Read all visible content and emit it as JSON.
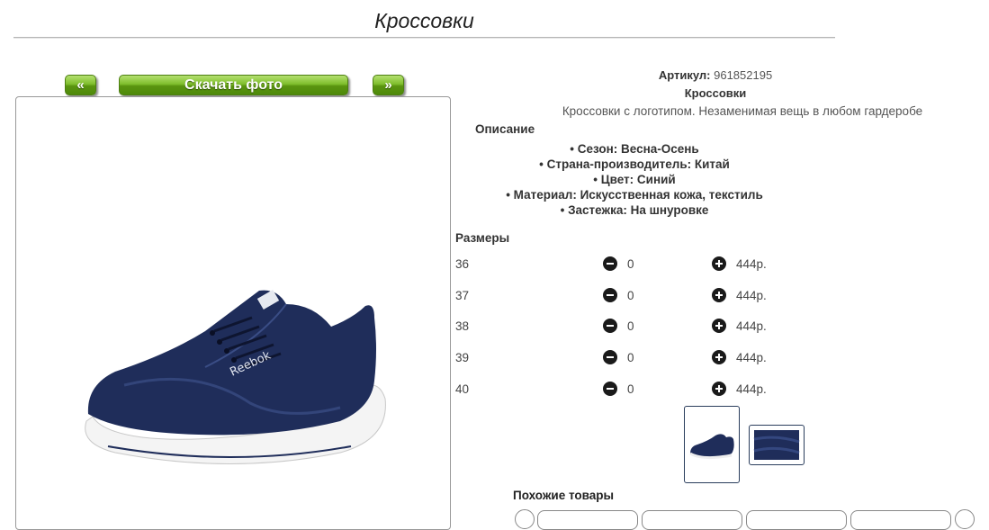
{
  "page_title": "Кроссовки",
  "nav": {
    "prev_label": "«",
    "download_label": "Скачать фото",
    "next_label": "»"
  },
  "product": {
    "sku_label": "Артикул:",
    "sku_value": "961852195",
    "name": "Кроссовки",
    "short_description": "Кроссовки с логотипом. Незаменимая вещь в любом гардеробе",
    "description_heading": "Описание",
    "features": [
      "• Сезон: Весна-Осень",
      "• Страна-производитель: Китай",
      "• Цвет: Синий",
      "• Материал: Искусственная кожа, текстиль",
      "• Застежка: На шнуровке"
    ],
    "shoe_logo_text": "Reebok"
  },
  "sizes": {
    "heading": "Размеры",
    "rows": [
      {
        "size": "36",
        "qty": "0",
        "price": "444р."
      },
      {
        "size": "37",
        "qty": "0",
        "price": "444р."
      },
      {
        "size": "38",
        "qty": "0",
        "price": "444р."
      },
      {
        "size": "39",
        "qty": "0",
        "price": "444р."
      },
      {
        "size": "40",
        "qty": "0",
        "price": "444р."
      }
    ]
  },
  "similar": {
    "heading": "Похожие товары"
  },
  "icons": {
    "decrease": "minus-circle-icon",
    "increase": "plus-circle-icon"
  },
  "colors": {
    "button_green": "#6aa81c",
    "shoe_navy": "#1f2d5a",
    "sole_white": "#f4f4f4"
  }
}
